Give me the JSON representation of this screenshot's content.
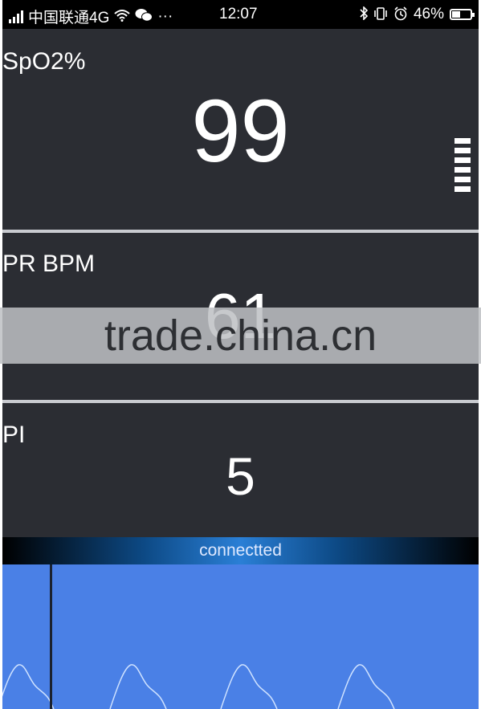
{
  "status_bar": {
    "carrier": "中国联通4G",
    "more": "···",
    "time": "12:07",
    "battery_percent": "46%",
    "battery_level": 0.46
  },
  "spo2": {
    "label": "SpO2%",
    "value": "99",
    "signal_bars": 6
  },
  "pr": {
    "label": "PR BPM",
    "value": "61"
  },
  "pi": {
    "label": "PI",
    "value": "5"
  },
  "connection": {
    "status": "connectted"
  },
  "waveform": {
    "pulse_count": 4
  },
  "watermark": "trade.china.cn",
  "colors": {
    "panel_bg": "#2b2d33",
    "wave_bg": "#4a80e6",
    "wave_line": "#cfe2ff",
    "accent": "#2a7fd6"
  }
}
